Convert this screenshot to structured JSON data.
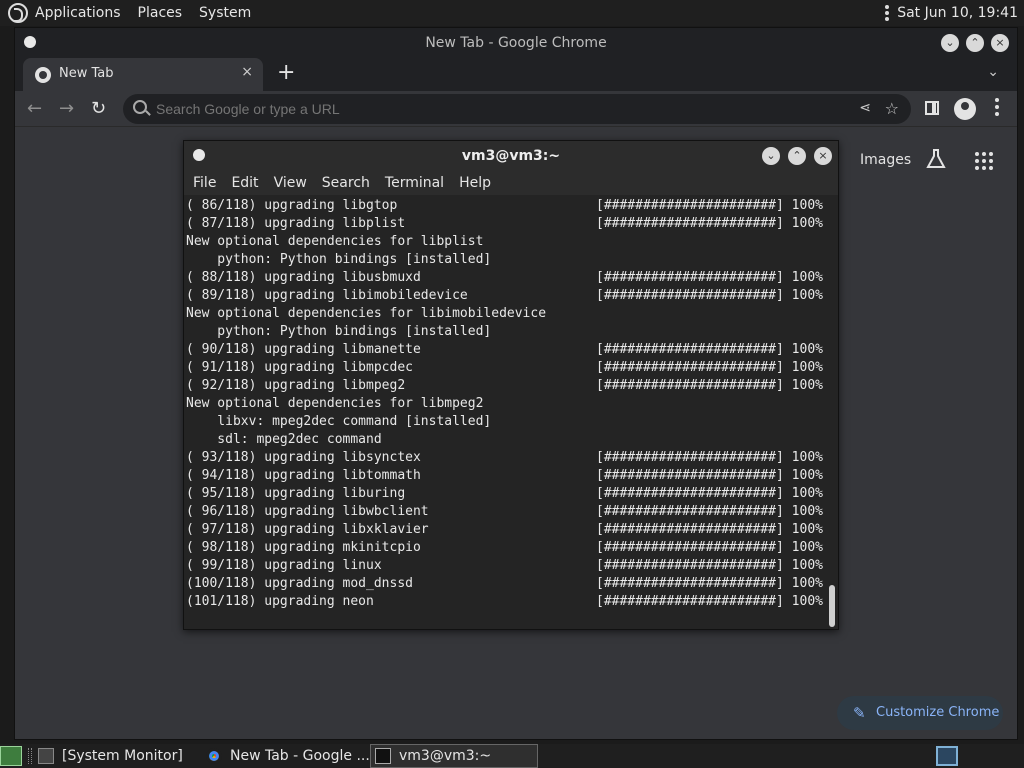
{
  "top_panel": {
    "menus": [
      "Applications",
      "Places",
      "System"
    ],
    "clock": "Sat Jun 10, 19:41"
  },
  "chrome": {
    "window_title": "New Tab - Google Chrome",
    "tab_label": "New Tab",
    "close_tab": "×",
    "new_tab": "+",
    "tab_list": "⌄",
    "omnibox_placeholder": "Search Google or type a URL",
    "ntp_link_images": "Images",
    "customize_label": "Customize Chrome"
  },
  "terminal": {
    "title": "vm3@vm3:~",
    "menus": [
      "File",
      "Edit",
      "View",
      "Search",
      "Terminal",
      "Help"
    ],
    "lines": [
      {
        "left": "( 86/118) upgrading libgtop",
        "bar": "[######################] 100%"
      },
      {
        "left": "( 87/118) upgrading libplist",
        "bar": "[######################] 100%"
      },
      {
        "left": "New optional dependencies for libplist",
        "bar": ""
      },
      {
        "left": "    python: Python bindings [installed]",
        "bar": ""
      },
      {
        "left": "( 88/118) upgrading libusbmuxd",
        "bar": "[######################] 100%"
      },
      {
        "left": "( 89/118) upgrading libimobiledevice",
        "bar": "[######################] 100%"
      },
      {
        "left": "New optional dependencies for libimobiledevice",
        "bar": ""
      },
      {
        "left": "    python: Python bindings [installed]",
        "bar": ""
      },
      {
        "left": "( 90/118) upgrading libmanette",
        "bar": "[######################] 100%"
      },
      {
        "left": "( 91/118) upgrading libmpcdec",
        "bar": "[######################] 100%"
      },
      {
        "left": "( 92/118) upgrading libmpeg2",
        "bar": "[######################] 100%"
      },
      {
        "left": "New optional dependencies for libmpeg2",
        "bar": ""
      },
      {
        "left": "    libxv: mpeg2dec command [installed]",
        "bar": ""
      },
      {
        "left": "    sdl: mpeg2dec command",
        "bar": ""
      },
      {
        "left": "( 93/118) upgrading libsynctex",
        "bar": "[######################] 100%"
      },
      {
        "left": "( 94/118) upgrading libtommath",
        "bar": "[######################] 100%"
      },
      {
        "left": "( 95/118) upgrading liburing",
        "bar": "[######################] 100%"
      },
      {
        "left": "( 96/118) upgrading libwbclient",
        "bar": "[######################] 100%"
      },
      {
        "left": "( 97/118) upgrading libxklavier",
        "bar": "[######################] 100%"
      },
      {
        "left": "( 98/118) upgrading mkinitcpio",
        "bar": "[######################] 100%"
      },
      {
        "left": "( 99/118) upgrading linux",
        "bar": "[######################] 100%"
      },
      {
        "left": "(100/118) upgrading mod_dnssd",
        "bar": "[######################] 100%"
      },
      {
        "left": "(101/118) upgrading neon",
        "bar": "[######################] 100%"
      }
    ]
  },
  "taskbar": {
    "items": [
      "[System Monitor]",
      "New Tab - Google ...",
      "vm3@vm3:~"
    ]
  },
  "colors": {
    "accent_link": "#8ab4f8",
    "terminal_bg": "#242424",
    "chrome_bg": "#35363a"
  }
}
